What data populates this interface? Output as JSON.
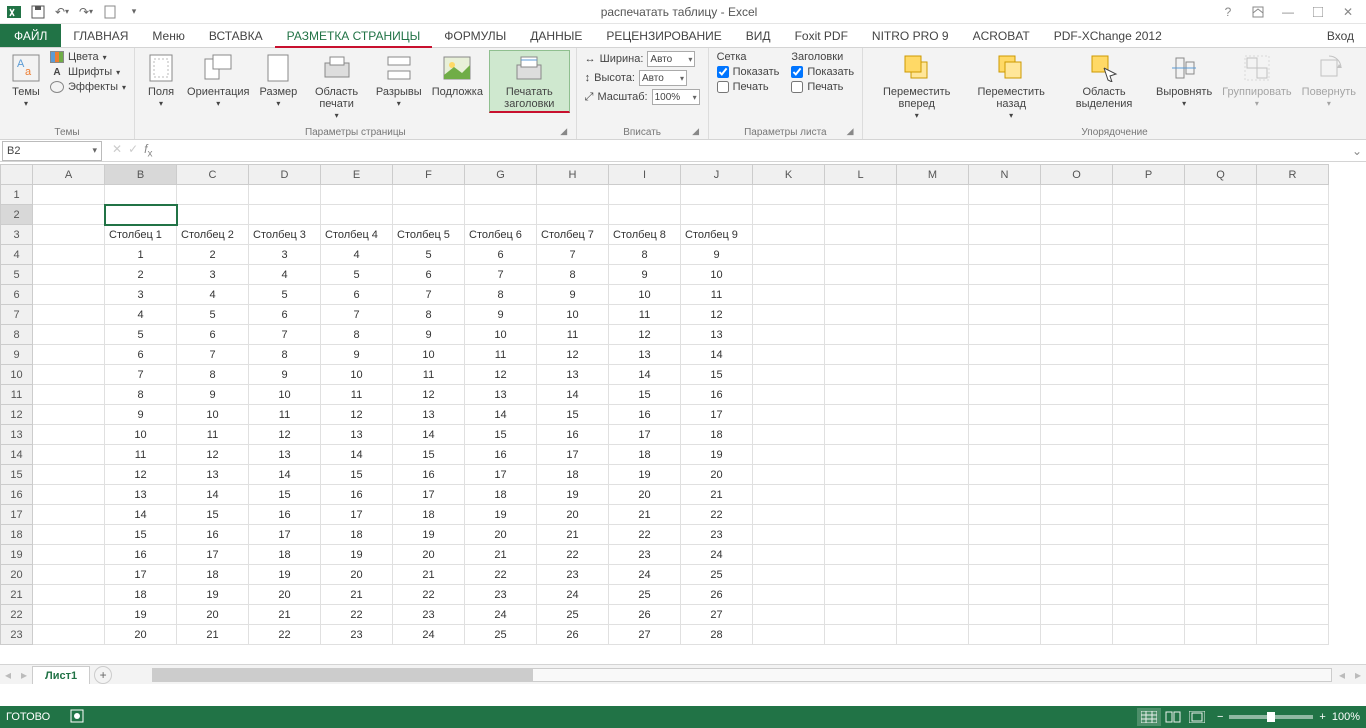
{
  "title": "распечатать таблицу - Excel",
  "tabs": {
    "file": "ФАЙЛ",
    "home": "ГЛАВНАЯ",
    "menu": "Меню",
    "insert": "ВСТАВКА",
    "pagelayout": "РАЗМЕТКА СТРАНИЦЫ",
    "formulas": "ФОРМУЛЫ",
    "data": "ДАННЫЕ",
    "review": "РЕЦЕНЗИРОВАНИЕ",
    "view": "ВИД",
    "foxit": "Foxit PDF",
    "nitro": "NITRO PRO 9",
    "acrobat": "ACROBAT",
    "pdfx": "PDF-XChange 2012",
    "login": "Вход"
  },
  "ribbon": {
    "themes": {
      "label": "Темы",
      "themes": "Темы",
      "colors": "Цвета",
      "fonts": "Шрифты",
      "effects": "Эффекты"
    },
    "page": {
      "label": "Параметры страницы",
      "margins": "Поля",
      "orient": "Ориентация",
      "size": "Размер",
      "area": "Область печати",
      "breaks": "Разрывы",
      "bg": "Подложка",
      "titles": "Печатать заголовки"
    },
    "fit": {
      "label": "Вписать",
      "width": "Ширина:",
      "height": "Высота:",
      "scale": "Масштаб:",
      "auto": "Авто",
      "scale_val": "100%"
    },
    "sheetopts": {
      "label": "Параметры листа",
      "grid": "Сетка",
      "headings": "Заголовки",
      "show": "Показать",
      "print": "Печать"
    },
    "arrange": {
      "label": "Упорядочение",
      "fwd": "Переместить вперед",
      "back": "Переместить назад",
      "selpane": "Область выделения",
      "align": "Выровнять",
      "group": "Группировать",
      "rotate": "Повернуть"
    }
  },
  "namebox": "B2",
  "cols": [
    "A",
    "B",
    "C",
    "D",
    "E",
    "F",
    "G",
    "H",
    "I",
    "J",
    "K",
    "L",
    "M",
    "N",
    "O",
    "P",
    "Q",
    "R"
  ],
  "rows_count": 23,
  "headers": [
    "Столбец 1",
    "Столбец 2",
    "Столбец 3",
    "Столбец 4",
    "Столбец 5",
    "Столбец 6",
    "Столбец 7",
    "Столбец 8",
    "Столбец 9"
  ],
  "data_rows": 20,
  "sheet_tab": "Лист1",
  "status": "ГОТОВО",
  "zoom": "100%"
}
